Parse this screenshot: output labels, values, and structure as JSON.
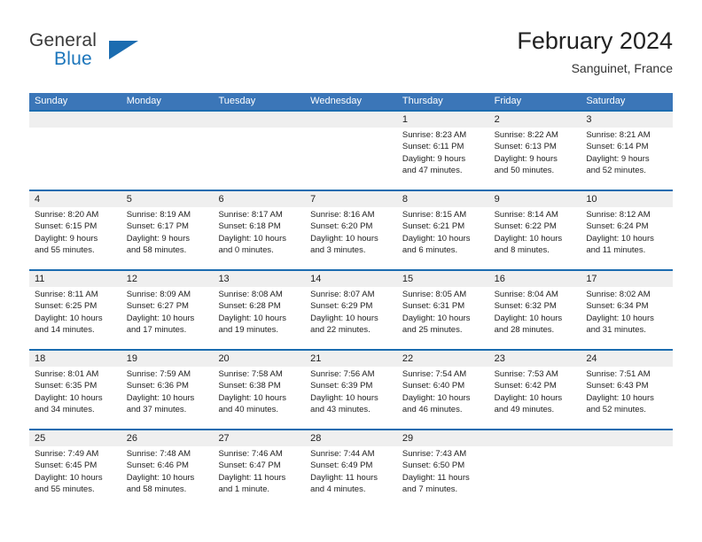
{
  "brand": {
    "name_part1": "General",
    "name_part2": "Blue",
    "accent_color": "#1b6cb0"
  },
  "header": {
    "title": "February 2024",
    "subtitle": "Sanguinet, France"
  },
  "calendar": {
    "header_bg": "#3b76b8",
    "row_divider_color": "#1b6cb0",
    "day_number_bg": "#efefef",
    "weekdays": [
      "Sunday",
      "Monday",
      "Tuesday",
      "Wednesday",
      "Thursday",
      "Friday",
      "Saturday"
    ],
    "weeks": [
      {
        "numbers": [
          "",
          "",
          "",
          "",
          "1",
          "2",
          "3"
        ],
        "details": [
          {
            "sunrise": "",
            "sunset": "",
            "daylight_line1": "",
            "daylight_line2": ""
          },
          {
            "sunrise": "",
            "sunset": "",
            "daylight_line1": "",
            "daylight_line2": ""
          },
          {
            "sunrise": "",
            "sunset": "",
            "daylight_line1": "",
            "daylight_line2": ""
          },
          {
            "sunrise": "",
            "sunset": "",
            "daylight_line1": "",
            "daylight_line2": ""
          },
          {
            "sunrise": "Sunrise: 8:23 AM",
            "sunset": "Sunset: 6:11 PM",
            "daylight_line1": "Daylight: 9 hours",
            "daylight_line2": "and 47 minutes."
          },
          {
            "sunrise": "Sunrise: 8:22 AM",
            "sunset": "Sunset: 6:13 PM",
            "daylight_line1": "Daylight: 9 hours",
            "daylight_line2": "and 50 minutes."
          },
          {
            "sunrise": "Sunrise: 8:21 AM",
            "sunset": "Sunset: 6:14 PM",
            "daylight_line1": "Daylight: 9 hours",
            "daylight_line2": "and 52 minutes."
          }
        ]
      },
      {
        "numbers": [
          "4",
          "5",
          "6",
          "7",
          "8",
          "9",
          "10"
        ],
        "details": [
          {
            "sunrise": "Sunrise: 8:20 AM",
            "sunset": "Sunset: 6:15 PM",
            "daylight_line1": "Daylight: 9 hours",
            "daylight_line2": "and 55 minutes."
          },
          {
            "sunrise": "Sunrise: 8:19 AM",
            "sunset": "Sunset: 6:17 PM",
            "daylight_line1": "Daylight: 9 hours",
            "daylight_line2": "and 58 minutes."
          },
          {
            "sunrise": "Sunrise: 8:17 AM",
            "sunset": "Sunset: 6:18 PM",
            "daylight_line1": "Daylight: 10 hours",
            "daylight_line2": "and 0 minutes."
          },
          {
            "sunrise": "Sunrise: 8:16 AM",
            "sunset": "Sunset: 6:20 PM",
            "daylight_line1": "Daylight: 10 hours",
            "daylight_line2": "and 3 minutes."
          },
          {
            "sunrise": "Sunrise: 8:15 AM",
            "sunset": "Sunset: 6:21 PM",
            "daylight_line1": "Daylight: 10 hours",
            "daylight_line2": "and 6 minutes."
          },
          {
            "sunrise": "Sunrise: 8:14 AM",
            "sunset": "Sunset: 6:22 PM",
            "daylight_line1": "Daylight: 10 hours",
            "daylight_line2": "and 8 minutes."
          },
          {
            "sunrise": "Sunrise: 8:12 AM",
            "sunset": "Sunset: 6:24 PM",
            "daylight_line1": "Daylight: 10 hours",
            "daylight_line2": "and 11 minutes."
          }
        ]
      },
      {
        "numbers": [
          "11",
          "12",
          "13",
          "14",
          "15",
          "16",
          "17"
        ],
        "details": [
          {
            "sunrise": "Sunrise: 8:11 AM",
            "sunset": "Sunset: 6:25 PM",
            "daylight_line1": "Daylight: 10 hours",
            "daylight_line2": "and 14 minutes."
          },
          {
            "sunrise": "Sunrise: 8:09 AM",
            "sunset": "Sunset: 6:27 PM",
            "daylight_line1": "Daylight: 10 hours",
            "daylight_line2": "and 17 minutes."
          },
          {
            "sunrise": "Sunrise: 8:08 AM",
            "sunset": "Sunset: 6:28 PM",
            "daylight_line1": "Daylight: 10 hours",
            "daylight_line2": "and 19 minutes."
          },
          {
            "sunrise": "Sunrise: 8:07 AM",
            "sunset": "Sunset: 6:29 PM",
            "daylight_line1": "Daylight: 10 hours",
            "daylight_line2": "and 22 minutes."
          },
          {
            "sunrise": "Sunrise: 8:05 AM",
            "sunset": "Sunset: 6:31 PM",
            "daylight_line1": "Daylight: 10 hours",
            "daylight_line2": "and 25 minutes."
          },
          {
            "sunrise": "Sunrise: 8:04 AM",
            "sunset": "Sunset: 6:32 PM",
            "daylight_line1": "Daylight: 10 hours",
            "daylight_line2": "and 28 minutes."
          },
          {
            "sunrise": "Sunrise: 8:02 AM",
            "sunset": "Sunset: 6:34 PM",
            "daylight_line1": "Daylight: 10 hours",
            "daylight_line2": "and 31 minutes."
          }
        ]
      },
      {
        "numbers": [
          "18",
          "19",
          "20",
          "21",
          "22",
          "23",
          "24"
        ],
        "details": [
          {
            "sunrise": "Sunrise: 8:01 AM",
            "sunset": "Sunset: 6:35 PM",
            "daylight_line1": "Daylight: 10 hours",
            "daylight_line2": "and 34 minutes."
          },
          {
            "sunrise": "Sunrise: 7:59 AM",
            "sunset": "Sunset: 6:36 PM",
            "daylight_line1": "Daylight: 10 hours",
            "daylight_line2": "and 37 minutes."
          },
          {
            "sunrise": "Sunrise: 7:58 AM",
            "sunset": "Sunset: 6:38 PM",
            "daylight_line1": "Daylight: 10 hours",
            "daylight_line2": "and 40 minutes."
          },
          {
            "sunrise": "Sunrise: 7:56 AM",
            "sunset": "Sunset: 6:39 PM",
            "daylight_line1": "Daylight: 10 hours",
            "daylight_line2": "and 43 minutes."
          },
          {
            "sunrise": "Sunrise: 7:54 AM",
            "sunset": "Sunset: 6:40 PM",
            "daylight_line1": "Daylight: 10 hours",
            "daylight_line2": "and 46 minutes."
          },
          {
            "sunrise": "Sunrise: 7:53 AM",
            "sunset": "Sunset: 6:42 PM",
            "daylight_line1": "Daylight: 10 hours",
            "daylight_line2": "and 49 minutes."
          },
          {
            "sunrise": "Sunrise: 7:51 AM",
            "sunset": "Sunset: 6:43 PM",
            "daylight_line1": "Daylight: 10 hours",
            "daylight_line2": "and 52 minutes."
          }
        ]
      },
      {
        "numbers": [
          "25",
          "26",
          "27",
          "28",
          "29",
          "",
          ""
        ],
        "details": [
          {
            "sunrise": "Sunrise: 7:49 AM",
            "sunset": "Sunset: 6:45 PM",
            "daylight_line1": "Daylight: 10 hours",
            "daylight_line2": "and 55 minutes."
          },
          {
            "sunrise": "Sunrise: 7:48 AM",
            "sunset": "Sunset: 6:46 PM",
            "daylight_line1": "Daylight: 10 hours",
            "daylight_line2": "and 58 minutes."
          },
          {
            "sunrise": "Sunrise: 7:46 AM",
            "sunset": "Sunset: 6:47 PM",
            "daylight_line1": "Daylight: 11 hours",
            "daylight_line2": "and 1 minute."
          },
          {
            "sunrise": "Sunrise: 7:44 AM",
            "sunset": "Sunset: 6:49 PM",
            "daylight_line1": "Daylight: 11 hours",
            "daylight_line2": "and 4 minutes."
          },
          {
            "sunrise": "Sunrise: 7:43 AM",
            "sunset": "Sunset: 6:50 PM",
            "daylight_line1": "Daylight: 11 hours",
            "daylight_line2": "and 7 minutes."
          },
          {
            "sunrise": "",
            "sunset": "",
            "daylight_line1": "",
            "daylight_line2": ""
          },
          {
            "sunrise": "",
            "sunset": "",
            "daylight_line1": "",
            "daylight_line2": ""
          }
        ]
      }
    ]
  }
}
